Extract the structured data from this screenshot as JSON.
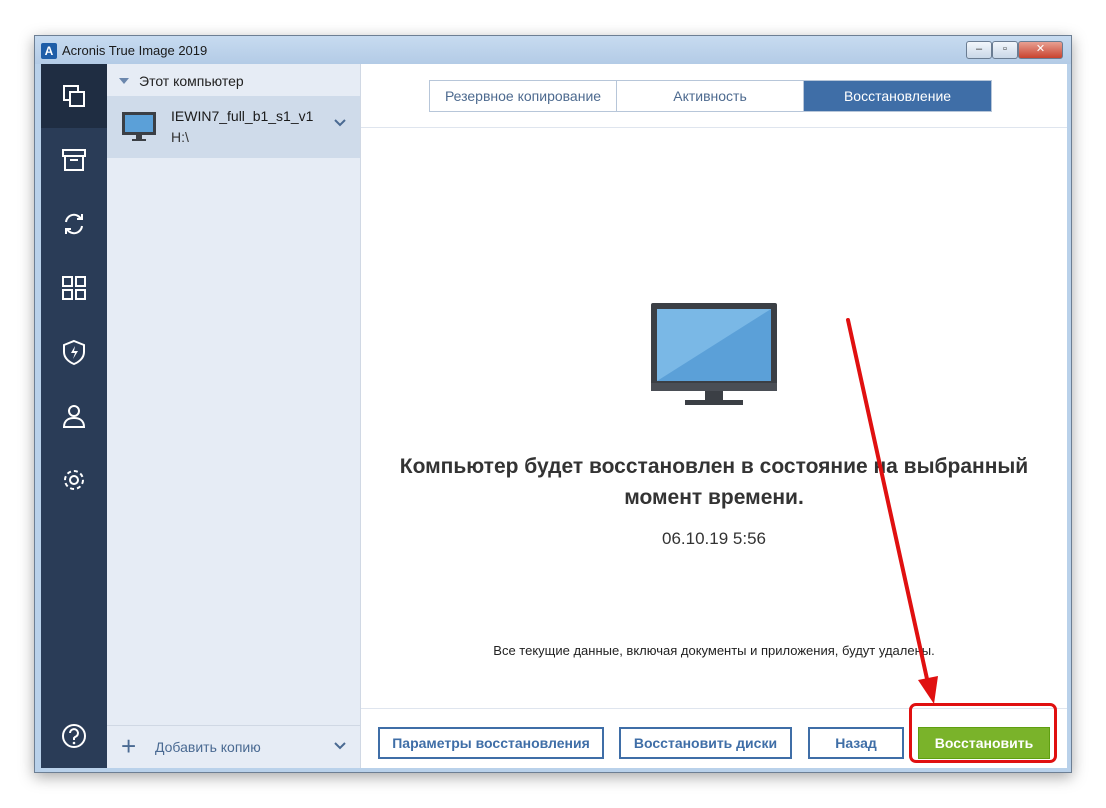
{
  "window": {
    "title": "Acronis True Image 2019",
    "logo_letter": "A",
    "controls": {
      "minimize": "–",
      "maximize": "▫",
      "close": "✕"
    }
  },
  "iconbar": {
    "items": [
      {
        "name": "backup-icon",
        "active": true
      },
      {
        "name": "archive-icon",
        "active": false
      },
      {
        "name": "sync-icon",
        "active": false
      },
      {
        "name": "tools-icon",
        "active": false
      },
      {
        "name": "protection-icon",
        "active": false
      },
      {
        "name": "account-icon",
        "active": false
      },
      {
        "name": "settings-icon",
        "active": false
      }
    ],
    "help_icon": "help-icon"
  },
  "sidebar": {
    "section_title": "Этот компьютер",
    "item": {
      "name": "IEWIN7_full_b1_s1_v1",
      "path": "H:\\"
    },
    "add_copy_label": "Добавить копию"
  },
  "tabs": [
    {
      "label": "Резервное копирование",
      "active": false
    },
    {
      "label": "Активность",
      "active": false
    },
    {
      "label": "Восстановление",
      "active": true
    }
  ],
  "main": {
    "headline_line1": "Компьютер будет восстановлен в состояние на выбранный",
    "headline_line2": "момент времени.",
    "datetime": "06.10.19 5:56",
    "warning": "Все текущие данные, включая документы и приложения, будут удалены."
  },
  "buttons": {
    "params": "Параметры восстановления",
    "disks": "Восстановить диски",
    "back": "Назад",
    "restore": "Восстановить"
  },
  "colors": {
    "iconbar_bg": "#2a3c57",
    "accent_blue": "#3f6ea7",
    "restore_green": "#7ab32a",
    "annotation_red": "#e01010"
  }
}
